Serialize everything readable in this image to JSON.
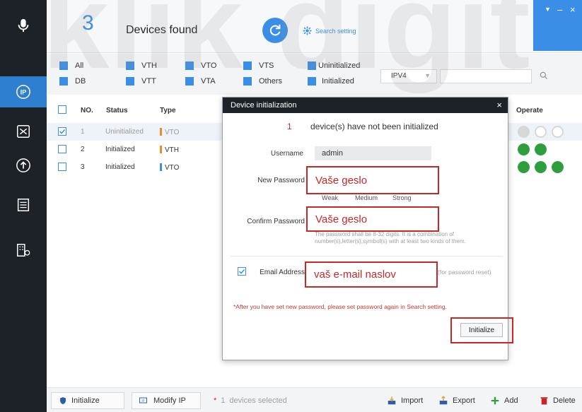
{
  "header": {
    "count": "3",
    "devices_found": "Devices found",
    "search_setting": "Search setting"
  },
  "filters": {
    "row1": [
      "All",
      "VTH",
      "VTO",
      "VTS",
      "Uninitialized"
    ],
    "row2": [
      "DB",
      "VTT",
      "VTA",
      "Others",
      "Initialized"
    ],
    "ip_version": "IPV4",
    "search_value": ""
  },
  "table": {
    "headers": [
      "NO.",
      "Status",
      "Type",
      "Operate"
    ],
    "rows": [
      {
        "no": "1",
        "status": "Uninitialized",
        "type": "VTO",
        "checked": true
      },
      {
        "no": "2",
        "status": "Initialized",
        "type": "VTH",
        "checked": false
      },
      {
        "no": "3",
        "status": "Initialized",
        "type": "VTO",
        "checked": false
      }
    ]
  },
  "footer": {
    "initialize": "Initialize",
    "modify_ip": "Modify IP",
    "selected_count": "1",
    "devices_selected": "devices selected",
    "import": "Import",
    "export": "Export",
    "add": "Add",
    "delete": "Delete"
  },
  "modal": {
    "title": "Device initialization",
    "uninit_count": "1",
    "uninit_text": "device(s) have not been initialized",
    "username_label": "Username",
    "username_value": "admin",
    "new_password_label": "New Password",
    "new_password_value": "Vaše geslo",
    "strength_weak": "Weak",
    "strength_medium": "Medium",
    "strength_strong": "Strong",
    "confirm_password_label": "Confirm Password",
    "confirm_password_value": "Vaše geslo",
    "password_hint": "The password shall be 8-32 digits. It is a combination of number(s),letter(s),symbol(s) with at least two kinds of them.",
    "email_label": "Email Address",
    "email_value": "vaš e-mail naslov",
    "email_hint": "(for password reset)",
    "note": "*After you have set new password, please set password again in Search setting.",
    "initialize_button": "Initialize"
  },
  "watermark": "klik digit",
  "colors": {
    "accent": "#3a8ee6",
    "sidebar": "#1d2228",
    "highlight_red": "#c62828",
    "type_bar": "#f08a24",
    "op_green": "#2e9e3e"
  }
}
